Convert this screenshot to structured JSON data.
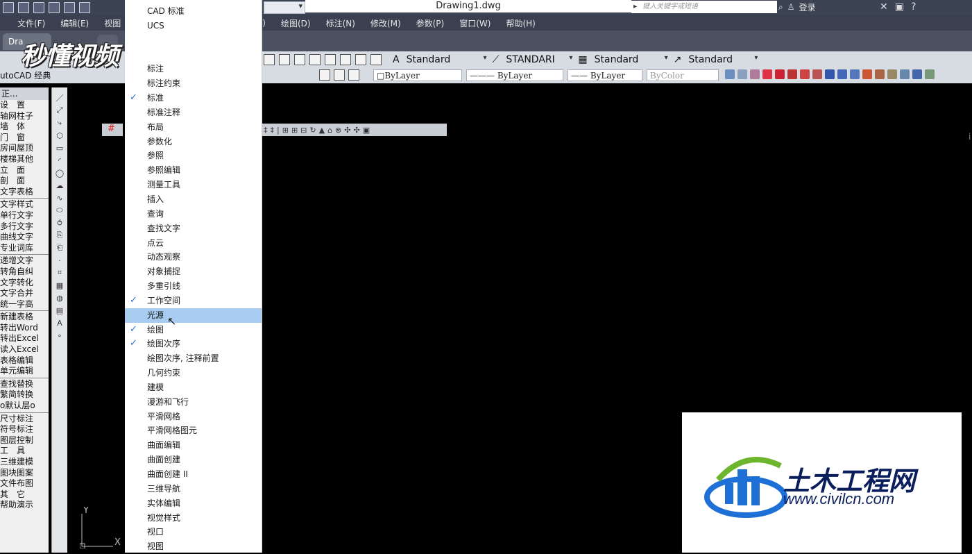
{
  "titlebar": {
    "document": "Drawing1.dwg",
    "search_placeholder": "键入关键字或短语",
    "login": "登录",
    "help_icon": "?"
  },
  "menubar": {
    "items": [
      "文件(F)",
      "编辑(E)",
      "视图",
      "(T)",
      "绘图(D)",
      "标注(N)",
      "修改(M)",
      "参数(P)",
      "窗口(W)",
      "帮助(H)"
    ]
  },
  "tabs": {
    "active": "Dra"
  },
  "watermark": "秒懂视频",
  "toolbar1": {
    "text_style": "Standard",
    "dim_style": "STANDARI",
    "table_style": "Standard",
    "mleader_style": "Standard"
  },
  "toolbar2": {
    "workspace": "utoCAD 经典",
    "layer": "□ByLayer",
    "linetype": "——— ByLayer",
    "lineweight": "—— ByLayer",
    "plotstyle": "ByColor"
  },
  "left_panel": {
    "header": "正...",
    "groups": [
      [
        "设　置",
        "轴网柱子",
        "墙　体",
        "门　窗",
        "房间屋顶",
        "楼梯其他",
        "立　面",
        "剖　面",
        "文字表格"
      ],
      [
        "文字样式",
        "单行文字",
        "多行文字",
        "曲线文字",
        "专业词库"
      ],
      [
        "递增文字",
        "转角自纠",
        "文字转化",
        "文字合并",
        "统一字高"
      ],
      [
        "新建表格",
        "转出Word",
        "转出Excel",
        "读入Excel",
        "表格编辑",
        "单元编辑"
      ],
      [
        "查找替换",
        "繁简转换",
        "o默认层o"
      ],
      [
        "尺寸标注",
        "符号标注",
        "图层控制",
        "工　具",
        "三维建模",
        "图块图案",
        "文件布图",
        "其　它",
        "帮助演示"
      ]
    ]
  },
  "context_menu": {
    "items": [
      {
        "label": "CAD 标准",
        "checked": false
      },
      {
        "label": "UCS",
        "checked": false
      },
      {
        "label": "",
        "checked": false
      },
      {
        "label": "",
        "checked": false
      },
      {
        "label": "标注",
        "checked": false
      },
      {
        "label": "标注约束",
        "checked": false
      },
      {
        "label": "标准",
        "checked": true
      },
      {
        "label": "标准注释",
        "checked": false
      },
      {
        "label": "布局",
        "checked": false
      },
      {
        "label": "参数化",
        "checked": false
      },
      {
        "label": "参照",
        "checked": false
      },
      {
        "label": "参照编辑",
        "checked": false
      },
      {
        "label": "测量工具",
        "checked": false
      },
      {
        "label": "插入",
        "checked": false
      },
      {
        "label": "查询",
        "checked": false
      },
      {
        "label": "查找文字",
        "checked": false
      },
      {
        "label": "点云",
        "checked": false
      },
      {
        "label": "动态观察",
        "checked": false
      },
      {
        "label": "对象捕捉",
        "checked": false
      },
      {
        "label": "多重引线",
        "checked": false
      },
      {
        "label": "工作空间",
        "checked": true
      },
      {
        "label": "光源",
        "checked": false,
        "highlighted": true
      },
      {
        "label": "绘图",
        "checked": true
      },
      {
        "label": "绘图次序",
        "checked": true
      },
      {
        "label": "绘图次序, 注释前置",
        "checked": false
      },
      {
        "label": "几何约束",
        "checked": false
      },
      {
        "label": "建模",
        "checked": false
      },
      {
        "label": "漫游和飞行",
        "checked": false
      },
      {
        "label": "平滑网格",
        "checked": false
      },
      {
        "label": "平滑网格图元",
        "checked": false
      },
      {
        "label": "曲面编辑",
        "checked": false
      },
      {
        "label": "曲面创建",
        "checked": false
      },
      {
        "label": "曲面创建 II",
        "checked": false
      },
      {
        "label": "三维导航",
        "checked": false
      },
      {
        "label": "实体编辑",
        "checked": false
      },
      {
        "label": "视觉样式",
        "checked": false
      },
      {
        "label": "视口",
        "checked": false
      },
      {
        "label": "视图",
        "checked": false
      }
    ]
  },
  "ucs": {
    "y": "Y",
    "x": "X"
  },
  "logo": {
    "name": "土木工程网",
    "url": "www.civilcn.com"
  },
  "colors": {
    "highlight": "#a8cdf0",
    "check": "#2a6fd0",
    "logo_text": "#0a1e5c",
    "logo_blue": "#1e6fd6",
    "logo_green": "#6cb52d"
  }
}
